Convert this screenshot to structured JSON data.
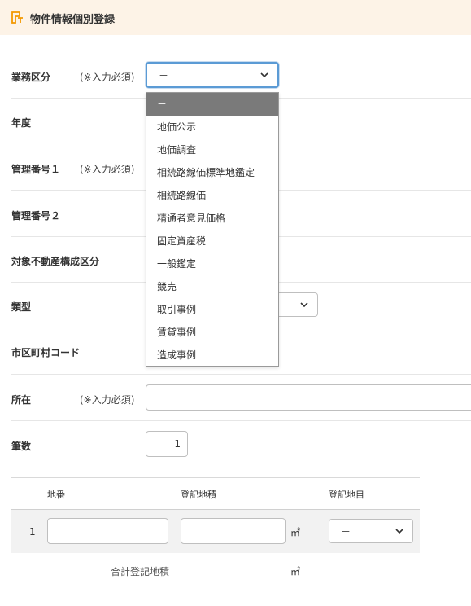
{
  "header": {
    "title": "物件情報個別登録"
  },
  "form": {
    "required_note": "(※入力必須)",
    "fields": {
      "gyomu_label": "業務区分",
      "nendo_label": "年度",
      "kanri1_label": "管理番号１",
      "kanri2_label": "管理番号２",
      "taisho_label": "対象不動産構成区分",
      "ruikei_label": "類型",
      "shiku_label": "市区町村コード",
      "shozai_label": "所在",
      "hissu_label": "筆数"
    },
    "gyomu_value": "－",
    "hissu_value": "1"
  },
  "dropdown": {
    "options": [
      "－",
      "地価公示",
      "地価調査",
      "相続路線価標準地鑑定",
      "相続路線価",
      "精通者意見価格",
      "固定資産税",
      "一般鑑定",
      "競売",
      "取引事例",
      "賃貸事例",
      "造成事例"
    ],
    "selected_index": 0
  },
  "parcel_table": {
    "headers": {
      "chiban": "地番",
      "menseki": "登記地積",
      "chimoku": "登記地目"
    },
    "rows": [
      {
        "no": "1",
        "unit": "㎡",
        "chimoku": "－"
      }
    ],
    "total_label": "合計登記地積",
    "total_unit": "㎡"
  },
  "colors": {
    "header_bg": "#fdf3e7",
    "accent": "#f39800",
    "focus": "#5b9bd5",
    "selected_option_bg": "#7a7a7a"
  }
}
